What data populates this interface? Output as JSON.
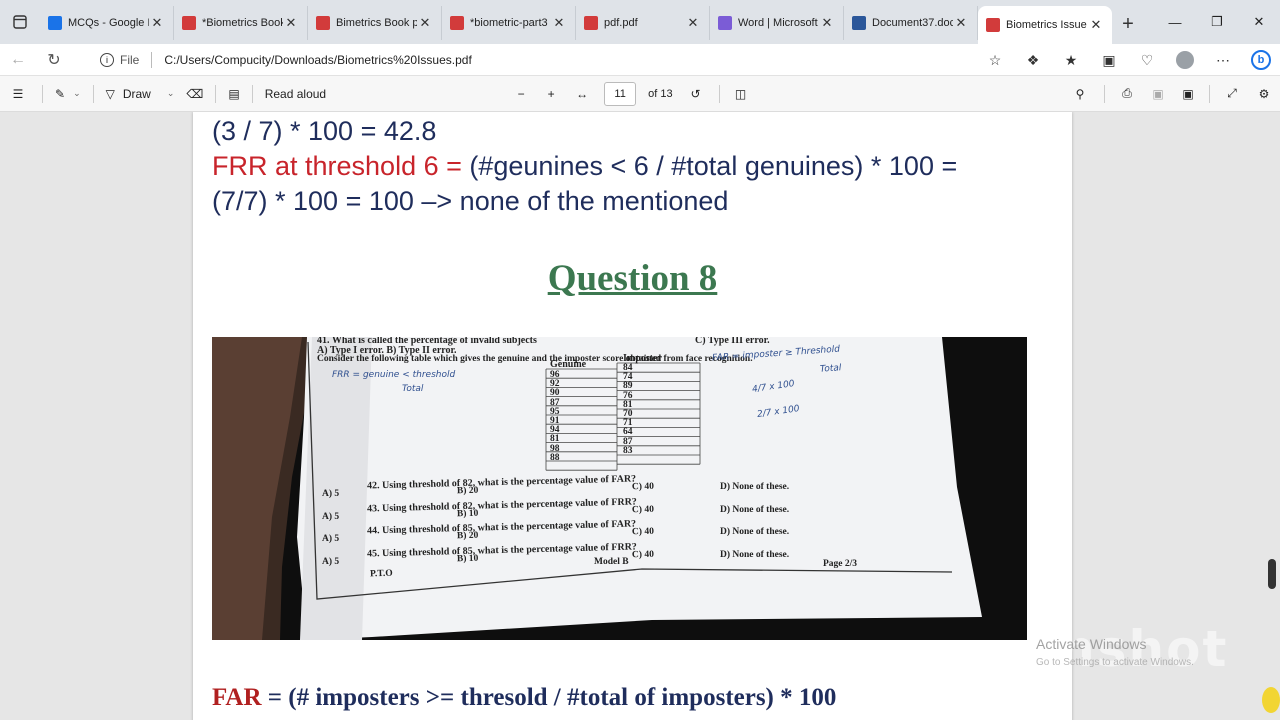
{
  "tabs": [
    {
      "title": "MCQs - Google D",
      "icon": "google-drive-icon",
      "color": "#1a73e8",
      "active": false
    },
    {
      "title": "*Biometrics Book",
      "icon": "pdf-icon",
      "color": "#d23b3b",
      "active": false
    },
    {
      "title": "Bimetrics Book p",
      "icon": "pdf-icon",
      "color": "#d23b3b",
      "active": false
    },
    {
      "title": "*biometric-part3",
      "icon": "pdf-icon",
      "color": "#d23b3b",
      "active": false
    },
    {
      "title": "pdf.pdf",
      "icon": "pdf-icon",
      "color": "#d23b3b",
      "active": false
    },
    {
      "title": "Word | Microsoft",
      "icon": "microsoft-365-icon",
      "color": "#7b5cd6",
      "active": false
    },
    {
      "title": "Document37.doc",
      "icon": "word-doc-icon",
      "color": "#2b579a",
      "active": false
    },
    {
      "title": "Biometrics Issue",
      "icon": "pdf-icon",
      "color": "#d23b3b",
      "active": true
    }
  ],
  "address": {
    "scheme_label": "File",
    "url": "C:/Users/Compucity/Downloads/Biometrics%20Issues.pdf"
  },
  "pdf_toolbar": {
    "draw_label": "Draw",
    "read_aloud_label": "Read aloud",
    "page_number": "11",
    "page_total": "of 13"
  },
  "document": {
    "line1": "(3 / 7)  * 100 = 42.8",
    "line2_red": "FRR at threshold 6 = ",
    "line2_rest": "(#geunines < 6 / #total genuines) * 100 =",
    "line3": "(7/7) * 100 = 100 –> none of the mentioned",
    "heading": "Question 8",
    "far_red": "FAR",
    "far_rest": " = (# imposters >= thresold / #total of imposters) * 100"
  },
  "photo": {
    "q41": "41. What is called the percentage of invalid subjects",
    "q41_opts": "A) Type I error.          B) Type II error.",
    "q41_c": "C) Type III error.",
    "consider": "Consider the following table which gives the genuine and the imposter score obtained from face recognition.",
    "table_headers": [
      "Genuine",
      "Imposter"
    ],
    "genuine": [
      "96",
      "92",
      "90",
      "87",
      "95",
      "91",
      "94",
      "81",
      "98",
      "88"
    ],
    "imposter": [
      "84",
      "74",
      "89",
      "76",
      "81",
      "70",
      "71",
      "64",
      "87",
      "83"
    ],
    "hand_frr": "FRR = genuine < threshold",
    "hand_total": "Total",
    "hand_far": "FAR = imposter ≥ Threshold",
    "hand_far_total": "Total",
    "hand_frac1": "4/7 x 100",
    "hand_frac2": "2/7 x 100",
    "questions": [
      {
        "text": "42. Using threshold of 82, what is the percentage value of FAR?",
        "a": "A) 5",
        "b": "B) 20",
        "c": "C) 40",
        "d": "D) None of these."
      },
      {
        "text": "43. Using threshold of 82, what is the percentage value of FRR?",
        "a": "A) 5",
        "b": "B) 10",
        "c": "C) 40",
        "d": "D) None of these."
      },
      {
        "text": "44. Using threshold of 85, what is the percentage value of FAR?",
        "a": "A) 5",
        "b": "B) 20",
        "c": "C) 40",
        "d": "D) None of these."
      },
      {
        "text": "45. Using threshold of 85, what is the percentage value of FRR?",
        "a": "A) 5",
        "b": "B) 10",
        "c": "C) 40",
        "d": "D) None of these."
      }
    ],
    "footer_left": "P.T.O",
    "footer_mid": "Model B",
    "footer_right": "Page 2/3"
  },
  "watermark": {
    "line1": "Activate Windows",
    "line2": "Go to Settings to activate Windows.",
    "logo": "inshot"
  }
}
